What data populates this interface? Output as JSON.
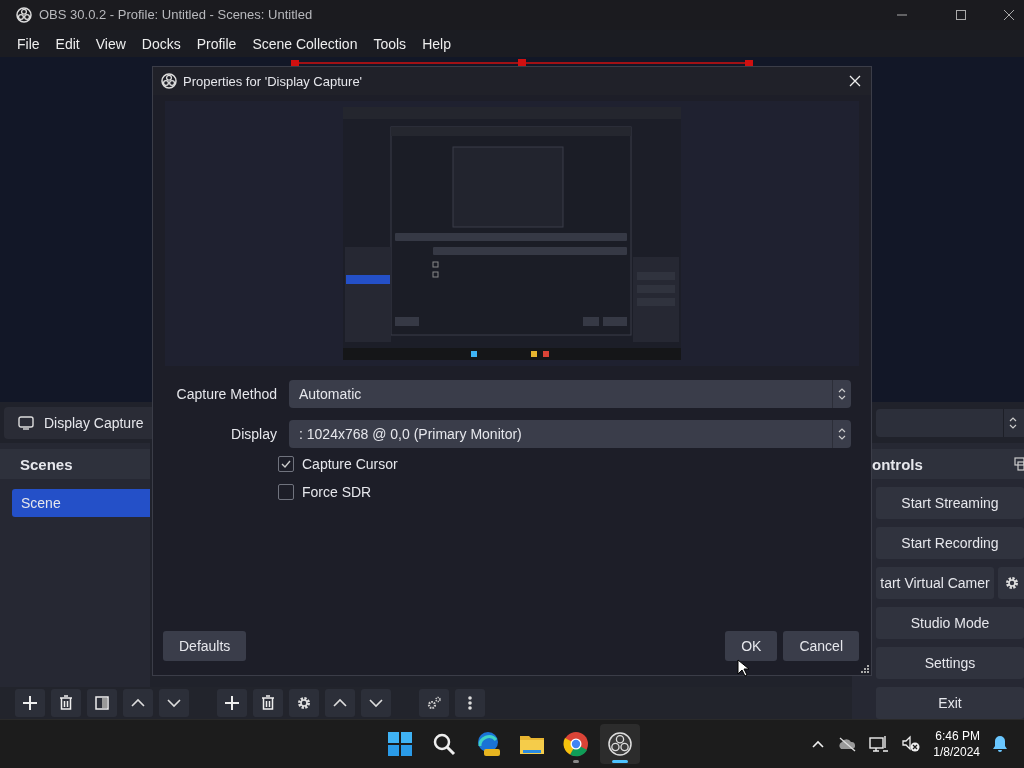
{
  "window": {
    "title": "OBS 30.0.2 - Profile: Untitled - Scenes: Untitled"
  },
  "menu": [
    "File",
    "Edit",
    "View",
    "Docks",
    "Profile",
    "Scene Collection",
    "Tools",
    "Help"
  ],
  "source_bar": {
    "source": "Display Capture"
  },
  "scenes": {
    "title": "Scenes",
    "items": [
      {
        "label": "Scene",
        "selected": true
      }
    ]
  },
  "controls": {
    "title": "ontrols",
    "buttons": [
      {
        "label": "Start Streaming",
        "kind": "plain"
      },
      {
        "label": "Start Recording",
        "kind": "plain"
      },
      {
        "label": "tart Virtual Camer",
        "kind": "with-settings"
      },
      {
        "label": "Studio Mode",
        "kind": "plain"
      },
      {
        "label": "Settings",
        "kind": "plain"
      },
      {
        "label": "Exit",
        "kind": "plain"
      }
    ]
  },
  "dialog": {
    "title": "Properties for 'Display Capture'",
    "fields": [
      {
        "label": "Capture Method",
        "value": "Automatic"
      },
      {
        "label": "Display",
        "value": ": 1024x768 @ 0,0 (Primary Monitor)"
      }
    ],
    "checkboxes": [
      {
        "label": "Capture Cursor",
        "checked": true
      },
      {
        "label": "Force SDR",
        "checked": false
      }
    ],
    "defaults_button": "Defaults",
    "buttons": [
      "OK",
      "Cancel"
    ]
  },
  "taskbar": {
    "apps": [
      {
        "kind": "start",
        "selected": false,
        "running": false
      },
      {
        "kind": "search",
        "selected": false,
        "running": false
      },
      {
        "kind": "edge",
        "selected": false,
        "running": false
      },
      {
        "kind": "folder",
        "selected": false,
        "running": false
      },
      {
        "kind": "chrome",
        "selected": false,
        "running": true
      },
      {
        "kind": "obs",
        "selected": true,
        "running": true
      }
    ],
    "time": "6:46 PM",
    "date": "1/8/2024"
  }
}
